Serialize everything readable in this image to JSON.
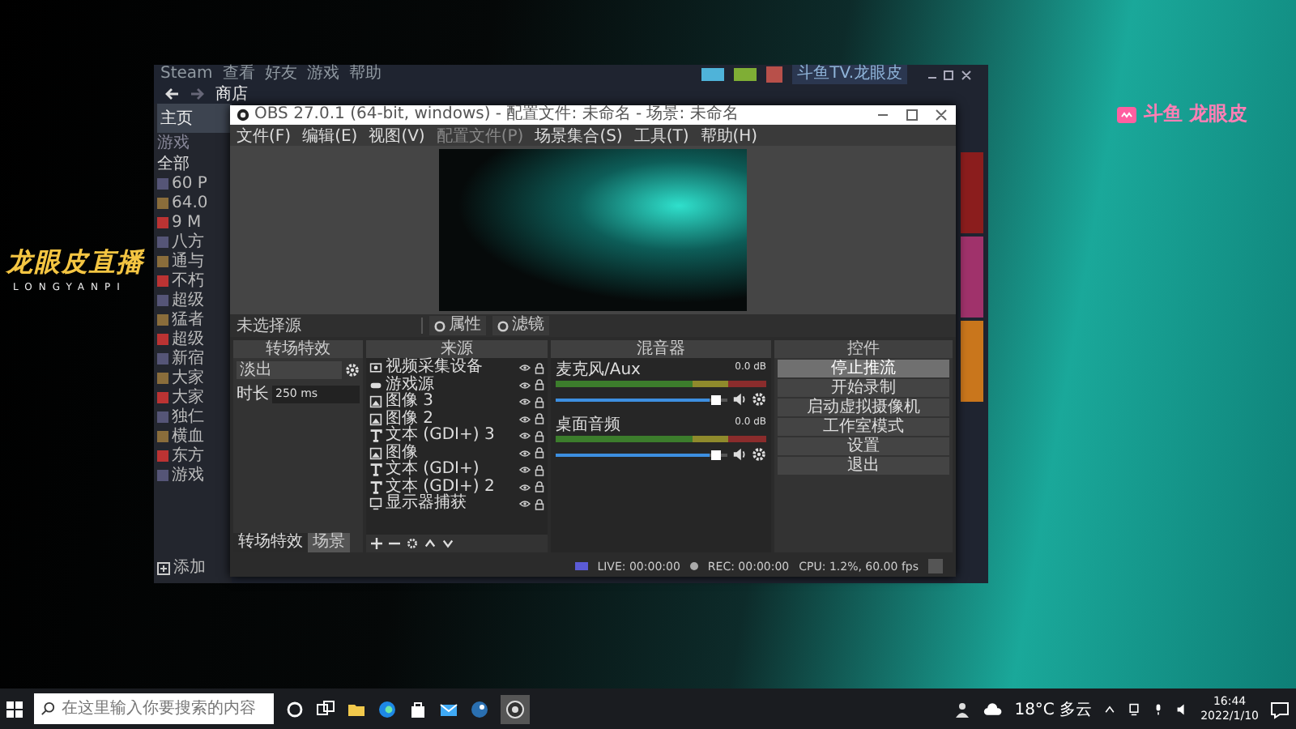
{
  "overlay": {
    "logo": "龙眼皮直播",
    "logo_sub": "LONGYANPI",
    "badge": "斗鱼 龙眼皮"
  },
  "steam": {
    "menu": [
      "Steam",
      "查看",
      "好友",
      "游戏",
      "帮助"
    ],
    "nav": "商店",
    "account": "斗鱼TV.龙眼皮",
    "home": "主页",
    "section": "游戏",
    "group": "全部",
    "games": [
      "60 P",
      "64.0",
      "9 M",
      "八方",
      "通与",
      "不朽",
      "超级",
      "猛者",
      "超级",
      "新宿",
      "大家",
      "大家",
      "独仁",
      "横血",
      "东方",
      "游戏"
    ],
    "add_game": "添加"
  },
  "obs": {
    "title": "OBS 27.0.1 (64-bit, windows) - 配置文件: 未命名 - 场景: 未命名",
    "menu": [
      "文件(F)",
      "编辑(E)",
      "视图(V)",
      "配置文件(P)",
      "场景集合(S)",
      "工具(T)",
      "帮助(H)"
    ],
    "source_bar": {
      "label": "未选择源",
      "buttons": [
        "属性",
        "滤镜"
      ]
    },
    "transitions": {
      "title": "转场特效",
      "selected": "淡出",
      "duration_label": "时长",
      "duration": "250 ms"
    },
    "sources": {
      "title": "来源",
      "items": [
        {
          "name": "视频采集设备",
          "kind": "camera"
        },
        {
          "name": "游戏源",
          "kind": "game"
        },
        {
          "name": "图像 3",
          "kind": "image"
        },
        {
          "name": "图像 2",
          "kind": "image"
        },
        {
          "name": "文本 (GDI+) 3",
          "kind": "text"
        },
        {
          "name": "图像",
          "kind": "image"
        },
        {
          "name": "文本 (GDI+)",
          "kind": "text"
        },
        {
          "name": "文本 (GDI+) 2",
          "kind": "text"
        },
        {
          "name": "显示器捕获",
          "kind": "monitor"
        }
      ]
    },
    "mixer": {
      "title": "混音器",
      "channels": [
        {
          "name": "麦克风/Aux",
          "reading": "0.0 dB",
          "level": 0.9
        },
        {
          "name": "桌面音频",
          "reading": "0.0 dB",
          "level": 0.9
        }
      ]
    },
    "controls": {
      "title": "控件",
      "buttons": [
        {
          "label": "停止推流",
          "active": true
        },
        {
          "label": "开始录制",
          "active": false
        },
        {
          "label": "启动虚拟摄像机",
          "active": false
        },
        {
          "label": "工作室模式",
          "active": false
        },
        {
          "label": "设置",
          "active": false
        },
        {
          "label": "退出",
          "active": false
        }
      ]
    },
    "dock_tabs": [
      {
        "label": "转场特效",
        "selected": true
      },
      {
        "label": "场景",
        "selected": false
      }
    ],
    "status": {
      "live": "LIVE: 00:00:00",
      "rec": "REC: 00:00:00",
      "cpu": "CPU: 1.2%, 60.00 fps"
    }
  },
  "taskbar": {
    "search": {
      "placeholder": "在这里输入你要搜索的内容"
    },
    "weather": "18°C 多云",
    "time": "16:44",
    "date": "2022/1/10"
  }
}
